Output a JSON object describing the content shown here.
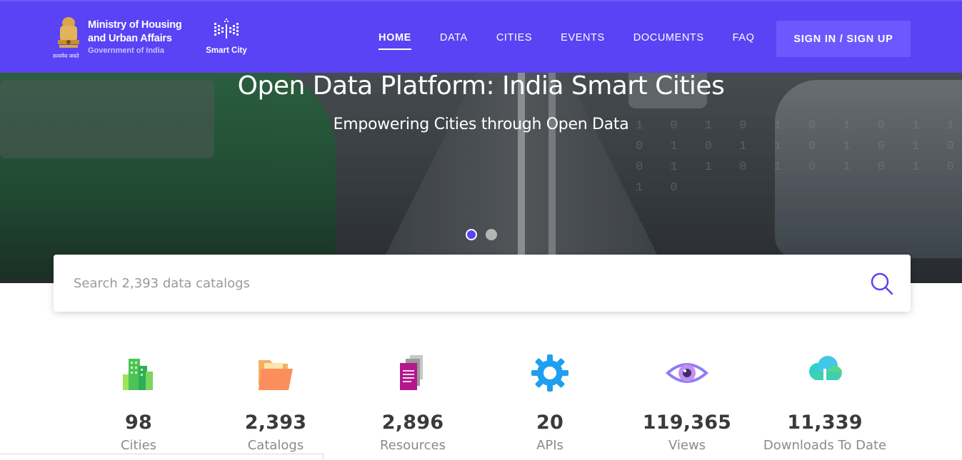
{
  "header": {
    "ministry_line1": "Ministry of Housing",
    "ministry_line2": "and Urban Affairs",
    "ministry_line3": "Government of India",
    "emblem_caption": "सत्यमेव जयते",
    "smart_city_label": "Smart City",
    "nav": [
      {
        "label": "HOME",
        "active": true
      },
      {
        "label": "DATA",
        "active": false
      },
      {
        "label": "CITIES",
        "active": false
      },
      {
        "label": "EVENTS",
        "active": false
      },
      {
        "label": "DOCUMENTS",
        "active": false
      },
      {
        "label": "FAQ",
        "active": false
      }
    ],
    "signin_label": "SIGN IN / SIGN UP",
    "accent_color": "#5a43f5"
  },
  "hero": {
    "title": "Open Data Platform: India Smart Cities",
    "subtitle": "Empowering Cities through Open Data",
    "slides": 2,
    "active_slide": 1,
    "digits_text": "1 0 1 0 1 0 1 0 1 1 0 1 0 1 1 0 1 0 1 0 0 1 1 0 1 0 1 0 1 0 1 0"
  },
  "search": {
    "placeholder": "Search 2,393 data catalogs",
    "value": ""
  },
  "stats": [
    {
      "value": "98",
      "label": "Cities",
      "icon": "buildings-icon"
    },
    {
      "value": "2,393",
      "label": "Catalogs",
      "icon": "folder-icon"
    },
    {
      "value": "2,896",
      "label": "Resources",
      "icon": "document-icon"
    },
    {
      "value": "20",
      "label": "APIs",
      "icon": "gear-icon"
    },
    {
      "value": "119,365",
      "label": "Views",
      "icon": "eye-icon"
    },
    {
      "value": "11,339",
      "label": "Downloads To Date",
      "icon": "cloud-download-icon"
    }
  ]
}
